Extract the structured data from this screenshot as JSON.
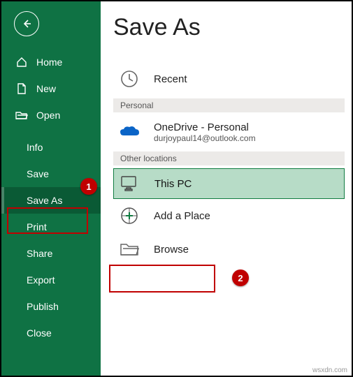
{
  "title": "Save As",
  "sidebar": {
    "home": "Home",
    "new": "New",
    "open": "Open",
    "info": "Info",
    "save": "Save",
    "save_as": "Save As",
    "print": "Print",
    "share": "Share",
    "export": "Export",
    "publish": "Publish",
    "close": "Close"
  },
  "sections": {
    "recent": "Recent",
    "personal_hdr": "Personal",
    "onedrive_title": "OneDrive - Personal",
    "onedrive_sub": "durjoypaul14@outlook.com",
    "other_hdr": "Other locations",
    "this_pc": "This PC",
    "add_place": "Add a Place",
    "browse": "Browse"
  },
  "annotations": {
    "badge1": "1",
    "badge2": "2"
  },
  "watermark": "wsxdn.com"
}
